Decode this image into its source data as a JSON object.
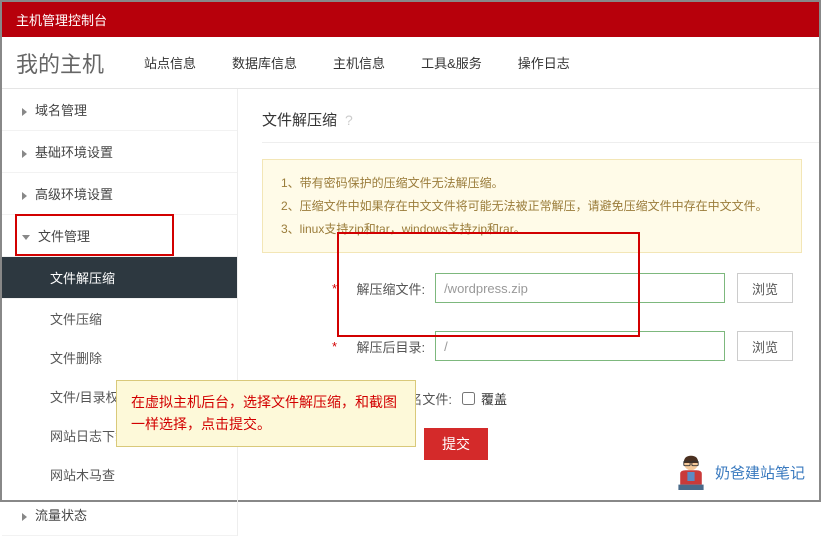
{
  "topbar": {
    "title": "主机管理控制台"
  },
  "header": {
    "title": "我的主机",
    "tabs": [
      "站点信息",
      "数据库信息",
      "主机信息",
      "工具&服务",
      "操作日志"
    ]
  },
  "sidebar": {
    "domain": "域名管理",
    "basic_env": "基础环境设置",
    "adv_env": "高级环境设置",
    "file_mgmt": "文件管理",
    "decompress": "文件解压缩",
    "compress": "文件压缩",
    "delete": "文件删除",
    "perm": "文件/目录权限设置",
    "log_dl": "网站日志下载",
    "trojan": "网站木马查",
    "traffic": "流量状态"
  },
  "content": {
    "title": "文件解压缩",
    "notice1": "1、带有密码保护的压缩文件无法解压缩。",
    "notice2": "2、压缩文件中如果存在中文文件将可能无法被正常解压，请避免压缩文件中存在中文文件。",
    "notice3": "3、linux支持zip和tar，windows支持zip和rar。",
    "label_src": "解压缩文件:",
    "val_src": "/wordpress.zip",
    "label_dst": "解压后目录:",
    "val_dst": "/",
    "browse": "浏览",
    "overwrite_label": "是否覆盖同名文件:",
    "overwrite_text": "覆盖",
    "submit": "提交"
  },
  "annotation": "在虚拟主机后台，选择文件解压缩，和截图一样选择，点击提交。",
  "watermark": "奶爸建站笔记"
}
